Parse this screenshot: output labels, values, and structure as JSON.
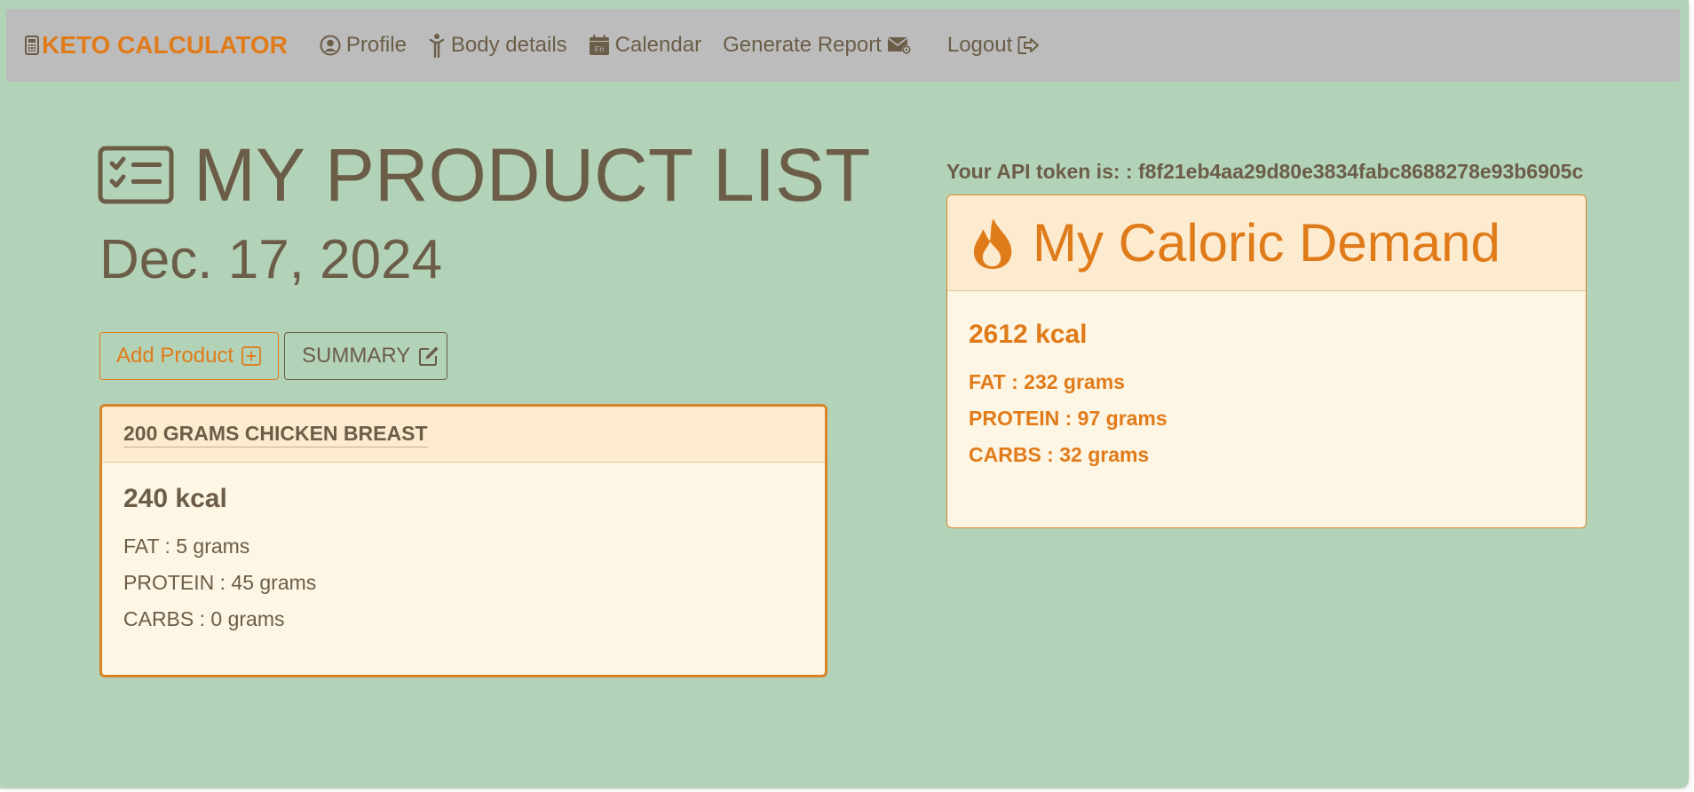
{
  "navbar": {
    "brand": "KETO CALCULATOR",
    "links": [
      {
        "label": "Profile",
        "icon": "user-circle-icon"
      },
      {
        "label": "Body details",
        "icon": "person-icon"
      },
      {
        "label": "Calendar",
        "icon": "calendar-icon",
        "icon_text": "Fri"
      },
      {
        "label": "Generate Report",
        "icon": "envelope-icon"
      },
      {
        "label": "Logout",
        "icon": "logout-icon"
      }
    ]
  },
  "main": {
    "title": "MY PRODUCT LIST",
    "date": "Dec. 17, 2024",
    "add_button": "Add Product",
    "summary_button": "SUMMARY"
  },
  "products": [
    {
      "name": "200 GRAMS CHICKEN BREAST",
      "kcal": "240 kcal",
      "fat": "FAT : 5 grams",
      "protein": "PROTEIN : 45 grams",
      "carbs": "CARBS : 0 grams"
    }
  ],
  "api_token": "Your API token is: : f8f21eb4aa29d80e3834fabc8688278e93b6905c",
  "demand": {
    "title": "My Caloric Demand",
    "kcal": "2612 kcal",
    "fat": "FAT : 232 grams",
    "protein": "PROTEIN : 97 grams",
    "carbs": "CARBS : 32 grams"
  },
  "colors": {
    "page_bg": "#b3d3b8",
    "navbar_bg": "#bcbcbc",
    "accent": "#e07b1a",
    "text": "#6b5d48",
    "card_bg": "#fef6e4",
    "card_header_bg": "#fdebd0"
  }
}
